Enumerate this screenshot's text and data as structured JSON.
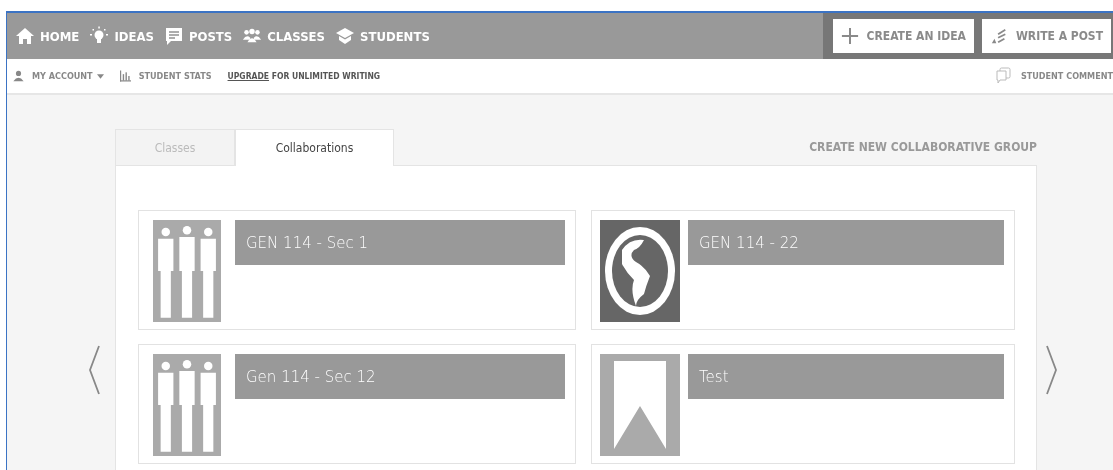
{
  "nav": {
    "items": [
      {
        "label": "HOME"
      },
      {
        "label": "IDEAS"
      },
      {
        "label": "POSTS"
      },
      {
        "label": "CLASSES"
      },
      {
        "label": "STUDENTS"
      }
    ],
    "actions": [
      {
        "label": "CREATE AN IDEA"
      },
      {
        "label": "WRITE A POST"
      }
    ]
  },
  "subbar": {
    "account": "MY ACCOUNT",
    "stats": "STUDENT STATS",
    "upgrade_link": "UPGRADE",
    "upgrade_text": "FOR UNLIMITED WRITING",
    "comments": "STUDENT COMMENT"
  },
  "tabs": [
    {
      "label": "Classes",
      "selected": false
    },
    {
      "label": "Collaborations",
      "selected": true
    }
  ],
  "create_group": "CREATE NEW COLLABORATIVE GROUP",
  "groups": [
    {
      "title": "GEN 114 - Sec 1",
      "kind": "people"
    },
    {
      "title": "GEN 114 - 22",
      "kind": "globe"
    },
    {
      "title": "Gen 114 - Sec 12",
      "kind": "people"
    },
    {
      "title": "Test",
      "kind": "bookmark"
    }
  ]
}
